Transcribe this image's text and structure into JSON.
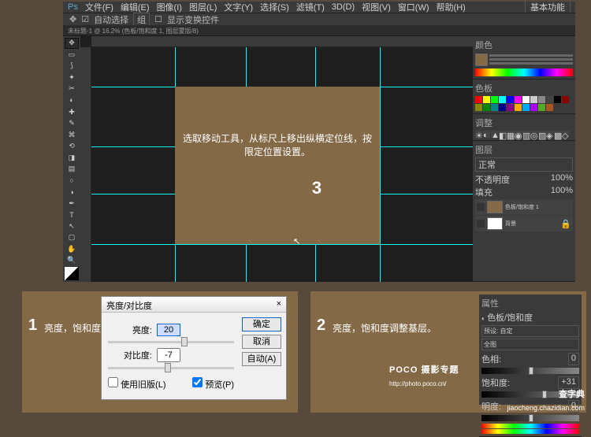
{
  "menu": [
    "文件(F)",
    "编辑(E)",
    "图像(I)",
    "图层(L)",
    "文字(Y)",
    "选择(S)",
    "滤镜(T)",
    "3D(D)",
    "视图(V)",
    "窗口(W)",
    "帮助(H)"
  ],
  "workspace_label": "基本功能",
  "options": {
    "autoselect": "自动选择",
    "group": "组",
    "showtransform": "显示变换控件"
  },
  "tab": "未标题-1 @ 16.2% (色板/饱和度 1, 图层蒙版/8)",
  "canvas": {
    "tip": "选取移动工具，从标尺上移出纵横定位线，按限定位置设置。",
    "big_num": "3"
  },
  "panels": {
    "color_tab": "颜色",
    "swatches_tab": "色板",
    "adjust_tab": "调整",
    "layers_tab": "图层",
    "normal": "正常",
    "opacity_label": "不透明度",
    "opacity_val": "100%",
    "fill_label": "填充",
    "fill_val": "100%",
    "layer1": "色板/饱和度 1",
    "layer2": "背景"
  },
  "card1": {
    "num": "1",
    "text": "亮度，饱和度调整基层。"
  },
  "dialog": {
    "title": "亮度/对比度",
    "brightness_label": "亮度:",
    "brightness_val": "20",
    "contrast_label": "对比度:",
    "contrast_val": "-7",
    "ok": "确定",
    "cancel": "取消",
    "auto": "自动(A)",
    "legacy": "使用旧版(L)",
    "preview": "预览(P)",
    "close_x": "×"
  },
  "card2": {
    "num": "2",
    "text": "亮度，饱和度调整基层。",
    "poco": "POCO 摄影专题",
    "poco_url": "http://photo.poco.cn/"
  },
  "mini": {
    "tab1": "属性",
    "tab2": "色板/饱和度",
    "preset": "预设: 自定",
    "master": "全图",
    "hue_label": "色相:",
    "hue_val": "0",
    "sat_label": "饱和度:",
    "sat_val": "+31",
    "light_label": "明度:",
    "light_val": "0"
  },
  "watermark": {
    "t": "查字典",
    "u": "jiaocheng.chazidian.com"
  }
}
